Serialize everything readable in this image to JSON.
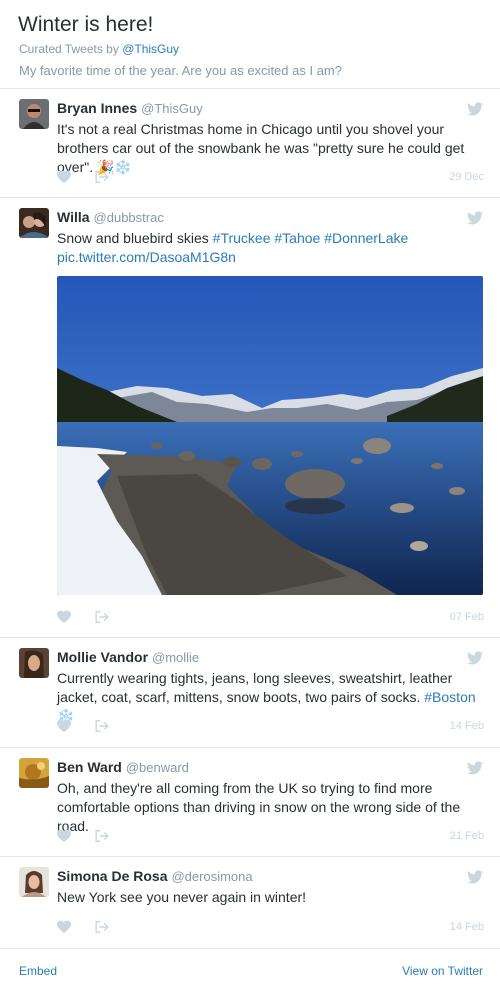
{
  "header": {
    "title": "Winter is here!",
    "curated_prefix": "Curated Tweets by",
    "curated_handle": "@ThisGuy",
    "description": "My favorite time of the year. Are you as excited as I am?"
  },
  "tweets": [
    {
      "name": "Bryan Innes",
      "handle": "@ThisGuy",
      "text": "It's not a real Christmas home in Chicago until you shovel your brothers car out of the snowbank he was \"pretty sure he could get over\".",
      "emoji": "🎉❄️",
      "date": "29 Dec"
    },
    {
      "name": "Willa",
      "handle": "@dubbstrac",
      "text_plain": "Snow and bluebird skies",
      "hashtags": [
        "#Truckee",
        "#Tahoe",
        "#DonnerLake"
      ],
      "pic_link": "pic.twitter.com/DasoaM1G8n",
      "date": "07 Feb"
    },
    {
      "name": "Mollie Vandor",
      "handle": "@mollie",
      "text": "Currently wearing tights, jeans, long sleeves, sweatshirt, leather jacket, coat, scarf, mittens, snow boots, two pairs of socks.",
      "hashtag": "#Boston",
      "emoji": "❄️",
      "date": "14 Feb"
    },
    {
      "name": "Ben Ward",
      "handle": "@benward",
      "text": "Oh, and they're all coming from the UK so trying to find more comfortable options than driving in snow on the wrong side of the road.",
      "date": "21 Feb"
    },
    {
      "name": "Simona De Rosa",
      "handle": "@derosimona",
      "text": "New York see you never again in winter!",
      "date": "14 Feb"
    }
  ],
  "footer": {
    "embed": "Embed",
    "view": "View on Twitter"
  },
  "colors": {
    "link": "#2b7bb9",
    "muted": "#8899a6",
    "icon": "#ccd6dd",
    "divider": "#e1e8ed"
  },
  "icons": [
    "twitter-bird-icon",
    "heart-icon",
    "share-icon"
  ]
}
